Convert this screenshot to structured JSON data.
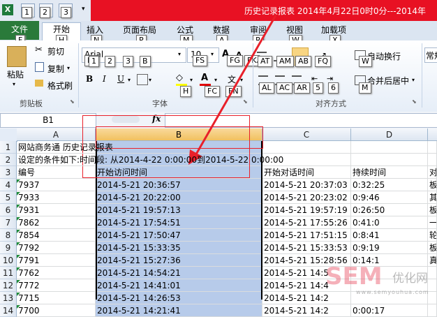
{
  "titlebar": {
    "title": "历史记录报表 2014年4月22日0时0分---2014年",
    "qat_keytips": [
      "1",
      "2",
      "3"
    ]
  },
  "ribbon": {
    "tabs": [
      {
        "label": "文件",
        "keytip": "F"
      },
      {
        "label": "开始",
        "keytip": "H"
      },
      {
        "label": "插入",
        "keytip": "N"
      },
      {
        "label": "页面布局",
        "keytip": "P"
      },
      {
        "label": "公式",
        "keytip": "M"
      },
      {
        "label": "数据",
        "keytip": "A"
      },
      {
        "label": "审阅",
        "keytip": "R"
      },
      {
        "label": "视图",
        "keytip": "W"
      },
      {
        "label": "加载项",
        "keytip": "X"
      }
    ],
    "clipboard": {
      "paste": "粘贴",
      "cut": "剪切",
      "copy": "复制",
      "format_painter": "格式刷",
      "group": "剪贴板"
    },
    "font": {
      "name": "Arial",
      "size": "10",
      "bold": "B",
      "italic": "I",
      "underline": "U",
      "fill_color": "#ffff00",
      "font_color": "#e00000",
      "group": "字体"
    },
    "alignment": {
      "wrap": "自动换行",
      "merge": "合并后居中",
      "group": "对齐方式"
    },
    "number": {
      "format": "常规"
    }
  },
  "formula_bar": {
    "name_box": "B1",
    "fx": "fx",
    "content": ""
  },
  "sheet": {
    "columns": [
      "A",
      "B",
      "C",
      "D"
    ],
    "row_numbers": [
      "1",
      "2",
      "3",
      "4",
      "5",
      "6",
      "7",
      "8",
      "9",
      "10",
      "11",
      "12",
      "13",
      "14"
    ],
    "row1": "网站商务通 历史记录报表",
    "row2": "设定的条件如下:时间段: 从2014-4-22 0:00:00到2014-5-22 0:00:00",
    "headers": [
      "编号",
      "开始访问时间",
      "开始对话时间",
      "持续时间",
      "对"
    ],
    "rows": [
      [
        "7937",
        "2014-5-21 20:36:57",
        "2014-5-21 20:37:03",
        "0:32:25",
        "板"
      ],
      [
        "7933",
        "2014-5-21 20:22:00",
        "2014-5-21 20:23:02",
        "0:9:46",
        "其"
      ],
      [
        "7931",
        "2014-5-21 19:57:13",
        "2014-5-21 19:57:19",
        "0:26:50",
        "板"
      ],
      [
        "7862",
        "2014-5-21 17:54:51",
        "2014-5-21 17:55:26",
        "0:41:0",
        "一"
      ],
      [
        "7854",
        "2014-5-21 17:50:47",
        "2014-5-21 17:51:15",
        "0:8:41",
        "轮"
      ],
      [
        "7792",
        "2014-5-21 15:33:35",
        "2014-5-21 15:33:53",
        "0:9:19",
        "板"
      ],
      [
        "7791",
        "2014-5-21 15:27:36",
        "2014-5-21 15:28:56",
        "0:14:1",
        "真"
      ],
      [
        "7762",
        "2014-5-21 14:54:21",
        "2014-5-21 14:5",
        "",
        ""
      ],
      [
        "7772",
        "2014-5-21 14:41:01",
        "2014-5-21 14:4",
        "",
        ""
      ],
      [
        "7715",
        "2014-5-21 14:26:53",
        "2014-5-21 14:2",
        "",
        ""
      ],
      [
        "7700",
        "2014-5-21 14:21:41",
        "2014-5-21 14:2",
        "0:00:17",
        ""
      ]
    ]
  },
  "watermark": {
    "brand": "SEM",
    "cn": "优化网",
    "url": "www.semyouhua.com"
  }
}
